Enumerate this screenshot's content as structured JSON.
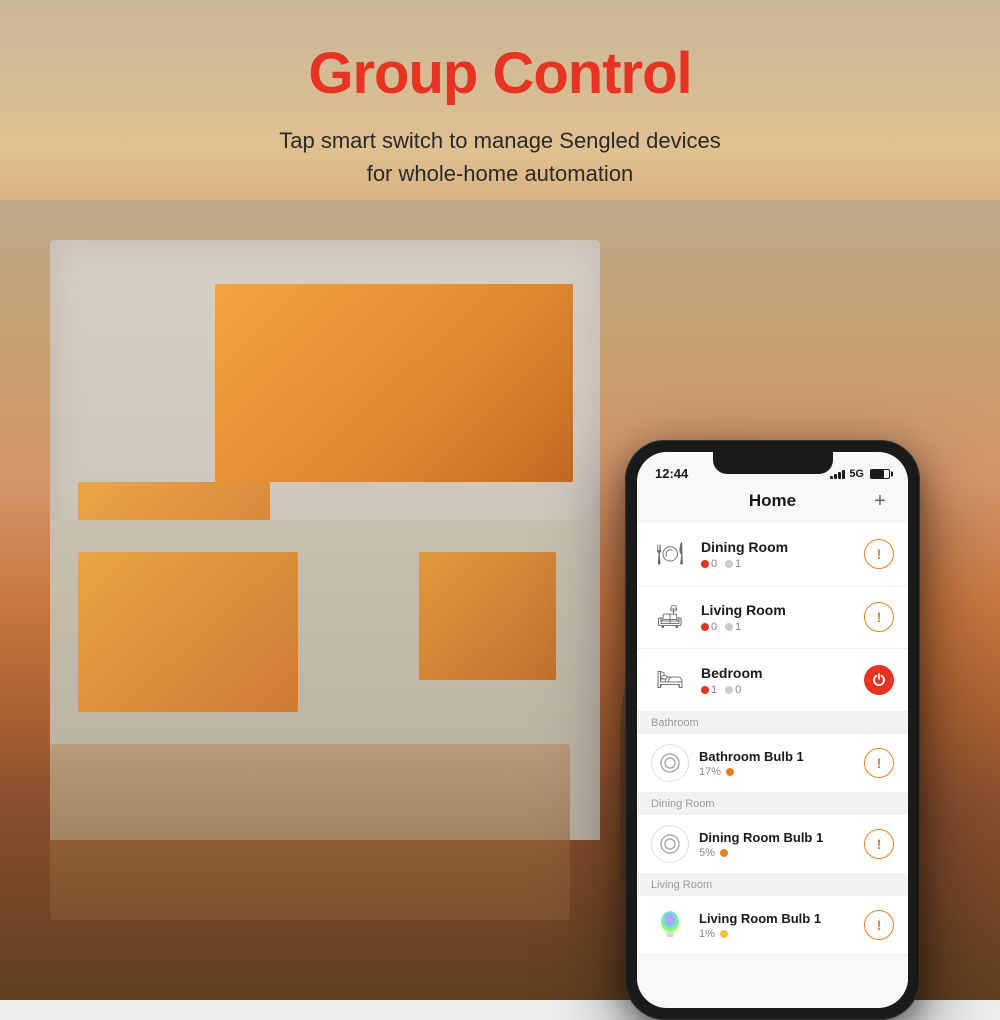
{
  "header": {
    "title": "Group Control",
    "subtitle_line1": "Tap smart switch to manage Sengled devices",
    "subtitle_line2": "for whole-home automation"
  },
  "phone": {
    "status": {
      "time": "12:44",
      "network": "5G",
      "battery_pct": 70
    },
    "app_title": "Home",
    "plus_label": "+",
    "rooms": [
      {
        "name": "Dining Room",
        "icon": "🍽",
        "devices_off": 0,
        "devices_on": 1,
        "action": "warn"
      },
      {
        "name": "Living Room",
        "icon": "🛋",
        "devices_off": 0,
        "devices_on": 1,
        "action": "warn"
      },
      {
        "name": "Bedroom",
        "icon": "🛏",
        "devices_off": 1,
        "devices_on": 0,
        "action": "power"
      }
    ],
    "sections": [
      {
        "section_name": "Bathroom",
        "bulbs": [
          {
            "name": "Bathroom Bulb 1",
            "brightness": "17%",
            "dot_color": "orange",
            "action": "warn",
            "icon_type": "ring"
          }
        ]
      },
      {
        "section_name": "Dining Room",
        "bulbs": [
          {
            "name": "Dining Room Bulb 1",
            "brightness": "5%",
            "dot_color": "orange",
            "action": "warn",
            "icon_type": "ring"
          }
        ]
      },
      {
        "section_name": "Living Room",
        "bulbs": [
          {
            "name": "Living Room Bulb 1",
            "brightness": "1%",
            "dot_color": "yellow",
            "action": "warn",
            "icon_type": "color"
          }
        ]
      }
    ]
  },
  "colors": {
    "title_red": "#e63322",
    "accent_orange": "#e88020",
    "accent_yellow": "#f0c040",
    "power_red": "#e63322"
  }
}
